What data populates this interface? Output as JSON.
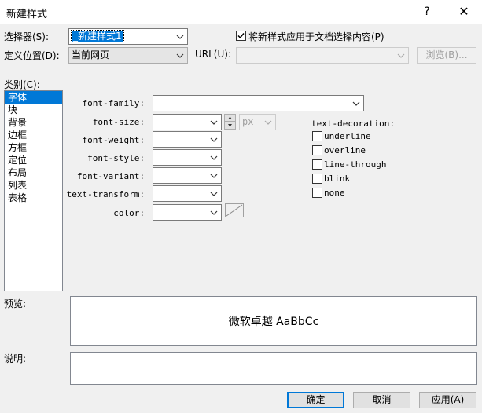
{
  "window": {
    "title": "新建样式",
    "help_label": "?",
    "close_label": "✕"
  },
  "selector": {
    "label": "选择器(S):",
    "value": "_新建样式1"
  },
  "apply_checkbox": {
    "label": "将新样式应用于文档选择内容(P)",
    "checked": true
  },
  "define_in": {
    "label": "定义位置(D):",
    "value": "当前网页"
  },
  "url": {
    "label": "URL(U):",
    "value": ""
  },
  "browse_button": "浏览(B)...",
  "category": {
    "label": "类别(C):",
    "items": [
      "字体",
      "块",
      "背景",
      "边框",
      "方框",
      "定位",
      "布局",
      "列表",
      "表格"
    ],
    "selected_index": 0
  },
  "font_properties": {
    "font_family_label": "font-family:",
    "font_size_label": "font-size:",
    "font_size_unit": "px",
    "font_weight_label": "font-weight:",
    "font_style_label": "font-style:",
    "font_variant_label": "font-variant:",
    "text_transform_label": "text-transform:",
    "color_label": "color:"
  },
  "text_decoration": {
    "label": "text-decoration:",
    "options": [
      "underline",
      "overline",
      "line-through",
      "blink",
      "none"
    ]
  },
  "preview": {
    "label": "预览:",
    "sample_text": "微软卓越 AaBbCc"
  },
  "description": {
    "label": "说明:",
    "text": ""
  },
  "buttons": {
    "ok": "确定",
    "cancel": "取消",
    "apply": "应用(A)"
  }
}
